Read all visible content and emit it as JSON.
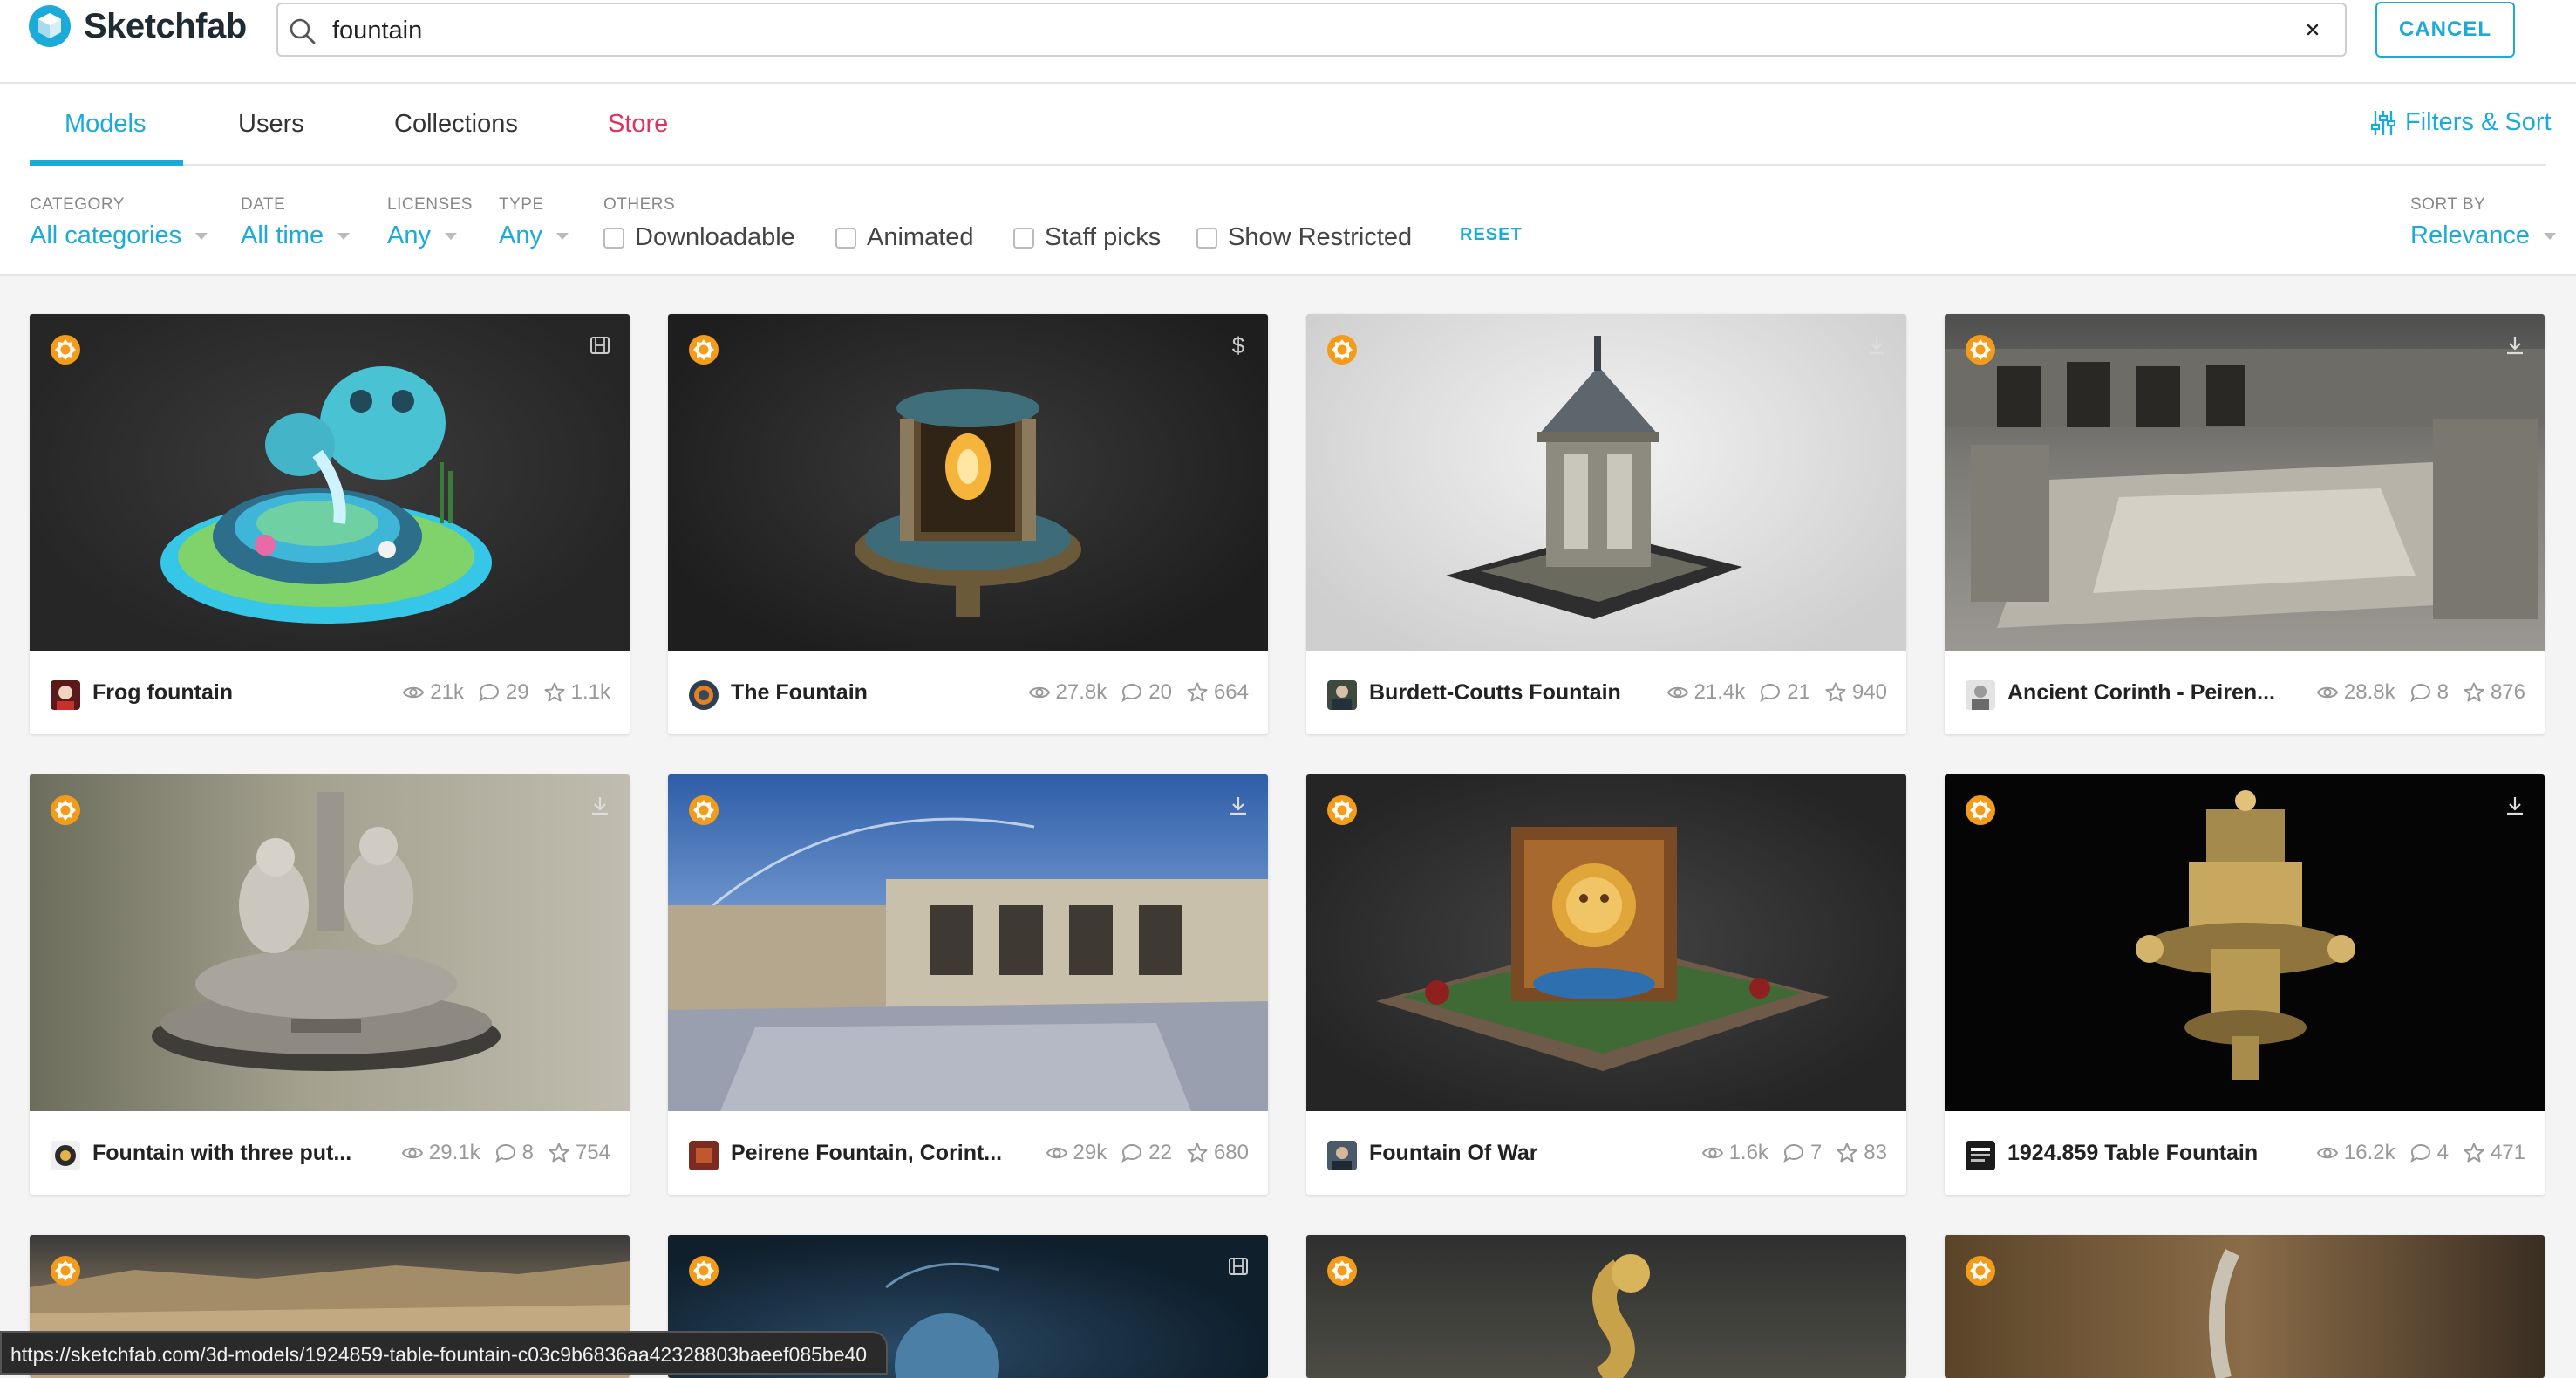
{
  "header": {
    "brand": "Sketchfab",
    "search_value": "fountain",
    "cancel_label": "CANCEL"
  },
  "tabs": [
    {
      "label": "Models",
      "active": true
    },
    {
      "label": "Users"
    },
    {
      "label": "Collections"
    },
    {
      "label": "Store"
    }
  ],
  "filters_sort_label": "Filters & Sort",
  "filters": {
    "category": {
      "label": "CATEGORY",
      "value": "All categories"
    },
    "date": {
      "label": "DATE",
      "value": "All time"
    },
    "licenses": {
      "label": "LICENSES",
      "value": "Any"
    },
    "type": {
      "label": "TYPE",
      "value": "Any"
    },
    "others_label": "OTHERS",
    "checkboxes": [
      "Downloadable",
      "Animated",
      "Staff picks",
      "Show Restricted"
    ],
    "reset_label": "RESET",
    "sort": {
      "label": "SORT BY",
      "value": "Relevance"
    }
  },
  "models": [
    {
      "title": "Frog fountain",
      "views": "21k",
      "comments": "29",
      "likes": "1.1k",
      "corner": "film-icon"
    },
    {
      "title": "The Fountain",
      "views": "27.8k",
      "comments": "20",
      "likes": "664",
      "corner": "dollar-icon"
    },
    {
      "title": "Burdett-Coutts Fountain",
      "views": "21.4k",
      "comments": "21",
      "likes": "940",
      "corner": "download-icon"
    },
    {
      "title": "Ancient Corinth - Peiren...",
      "views": "28.8k",
      "comments": "8",
      "likes": "876",
      "corner": "download-icon"
    },
    {
      "title": "Fountain with three put...",
      "views": "29.1k",
      "comments": "8",
      "likes": "754",
      "corner": "download-icon"
    },
    {
      "title": "Peirene Fountain, Corint...",
      "views": "29k",
      "comments": "22",
      "likes": "680",
      "corner": "download-icon"
    },
    {
      "title": "Fountain Of War",
      "views": "1.6k",
      "comments": "7",
      "likes": "83",
      "corner": ""
    },
    {
      "title": "1924.859 Table Fountain",
      "views": "16.2k",
      "comments": "4",
      "likes": "471",
      "corner": "download-icon"
    }
  ],
  "status_url": "https://sketchfab.com/3d-models/1924859-table-fountain-c03c9b6836aa42328803baeef085be40",
  "colors": {
    "accent": "#1caad9",
    "store": "#e0325f",
    "staff_badge": "#f39c1c"
  }
}
